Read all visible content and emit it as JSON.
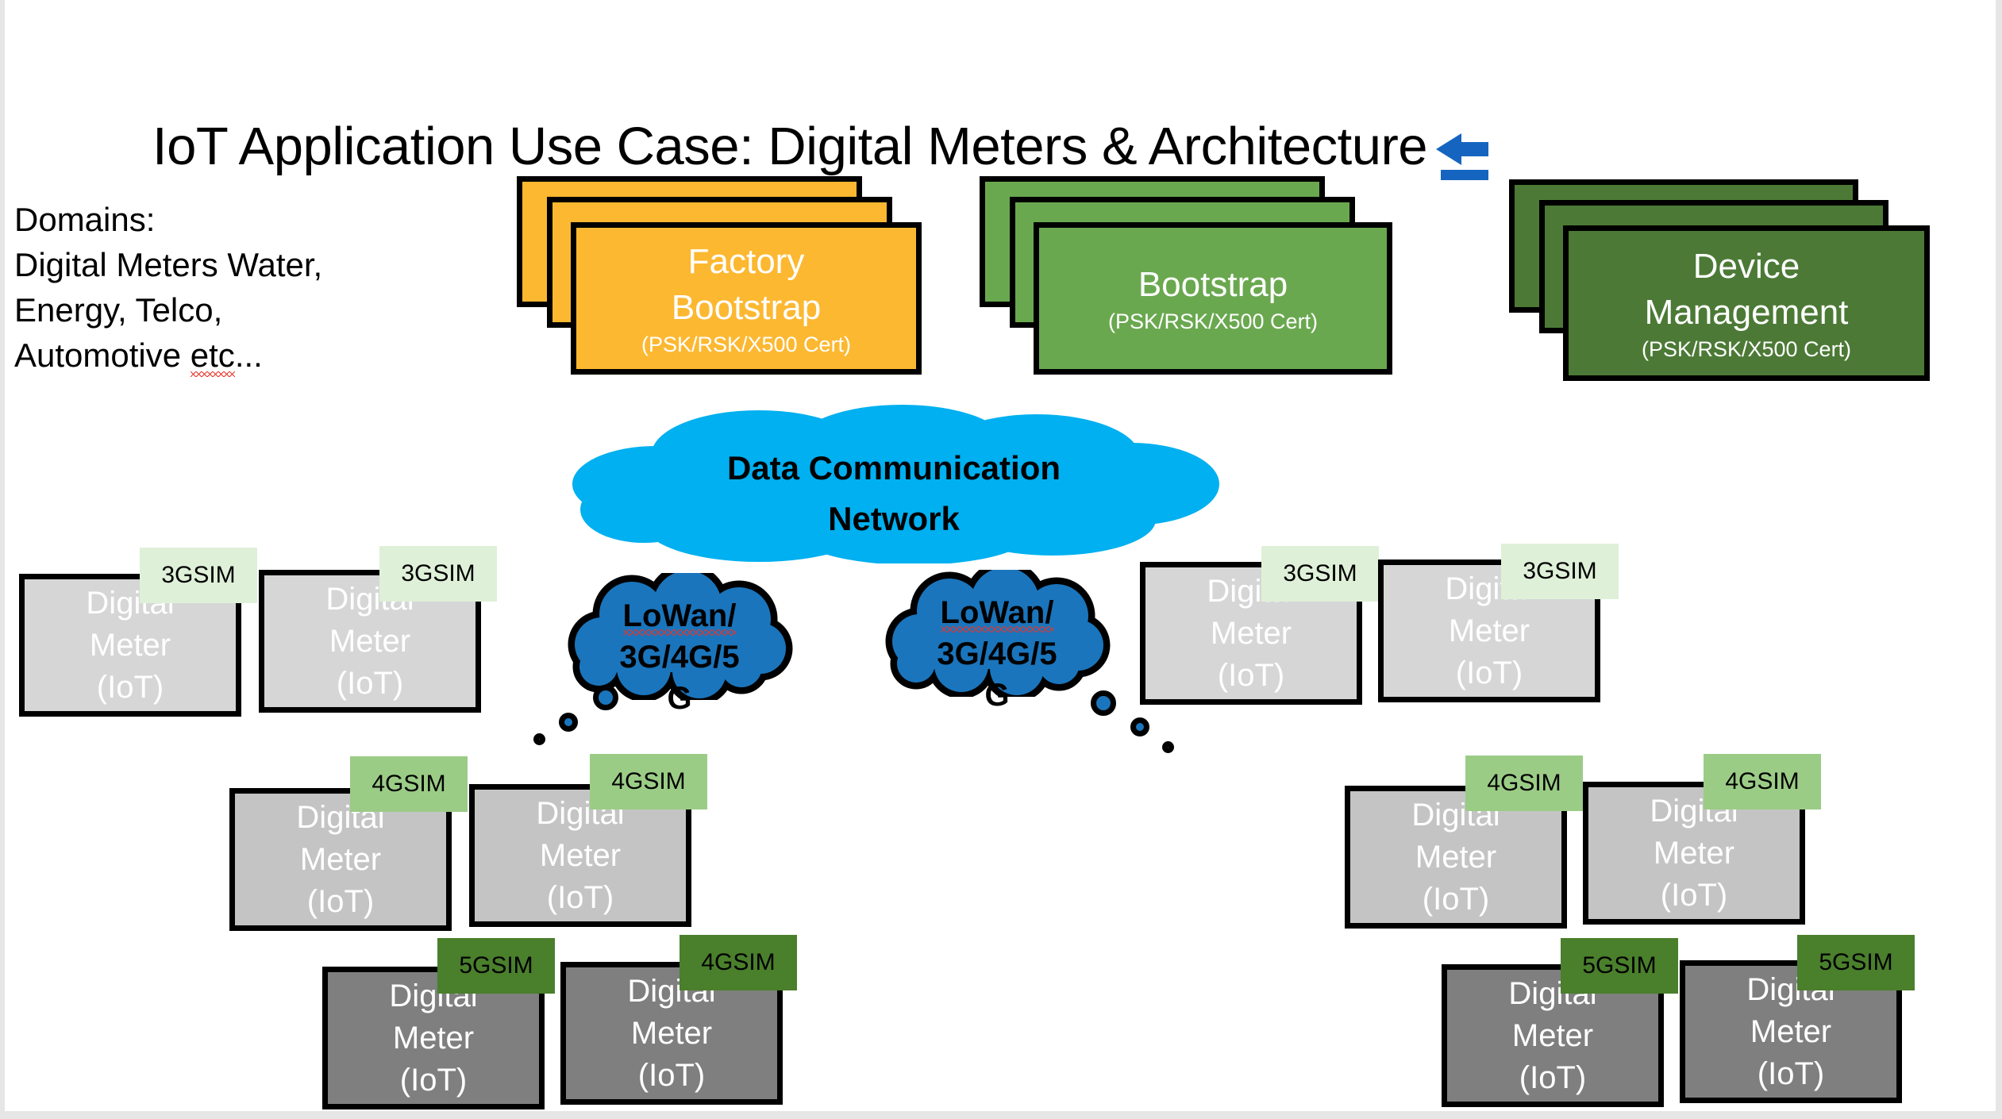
{
  "slide": {
    "title": "IoT Application Use Case: Digital Meters & Architecture",
    "title_arrow_icon": "arrow-left-icon",
    "domains_label": "Domains:",
    "domains_line2": "Digital Meters Water,",
    "domains_line3": "Energy, Telco,",
    "domains_line4_a": "Automotive ",
    "domains_line4_b": "etc",
    "domains_line4_c": "..."
  },
  "colors": {
    "factory_bootstrap": "#fcb831",
    "bootstrap": "#6aa84f",
    "device_management": "#4c7a36",
    "network_cloud": "#00b0f0",
    "lowan_cloud": "#1a75bc",
    "sim3_tag": "#dff0d8",
    "sim4_tag": "#9bcc86",
    "sim5_tag": "#4a7f2c",
    "meter_light": "#d6d6d6",
    "meter_mid": "#c4c4c4",
    "meter_dark": "#7f7f7f",
    "title_arrow": "#1565c0",
    "outline": "#000000"
  },
  "services": [
    {
      "name": "factory-bootstrap",
      "title_line1": "Factory",
      "title_line2": "Bootstrap",
      "subtitle": "(PSK/RSK/X500 Cert)",
      "fill": "#fcb831"
    },
    {
      "name": "bootstrap",
      "title_line1": "Bootstrap",
      "title_line2": "",
      "subtitle": "(PSK/RSK/X500 Cert)",
      "fill": "#6aa84f"
    },
    {
      "name": "device-management",
      "title_line1": "Device",
      "title_line2": "Management",
      "subtitle": "(PSK/RSK/X500 Cert)",
      "fill": "#4c7a36"
    }
  ],
  "network_cloud": {
    "line1": "Data Communication",
    "line2": "Network"
  },
  "lowan_clouds": [
    {
      "line1": "LoWan/",
      "line2": "3G/4G/5",
      "line3": "G"
    },
    {
      "line1": "LoWan/",
      "line2": "3G/4G/5",
      "line3": "G"
    }
  ],
  "meters": [
    {
      "id": "m1",
      "line1": "Digital",
      "line2": "Meter",
      "line3": "(IoT)",
      "sim": "3GSIM",
      "tier": "3g",
      "side": "left"
    },
    {
      "id": "m2",
      "line1": "Digital",
      "line2": "Meter",
      "line3": "(IoT)",
      "sim": "3GSIM",
      "tier": "3g",
      "side": "left"
    },
    {
      "id": "m3",
      "line1": "Digital",
      "line2": "Meter",
      "line3": "(IoT)",
      "sim": "4GSIM",
      "tier": "4g",
      "side": "left"
    },
    {
      "id": "m4",
      "line1": "Digital",
      "line2": "Meter",
      "line3": "(IoT)",
      "sim": "4GSIM",
      "tier": "4g",
      "side": "left"
    },
    {
      "id": "m5",
      "line1": "Digital",
      "line2": "Meter",
      "line3": "(IoT)",
      "sim": "5GSIM",
      "tier": "5g",
      "side": "left"
    },
    {
      "id": "m6",
      "line1": "Digital",
      "line2": "Meter",
      "line3": "(IoT)",
      "sim": "4GSIM",
      "tier": "5g",
      "side": "left"
    },
    {
      "id": "m7",
      "line1": "Digital",
      "line2": "Meter",
      "line3": "(IoT)",
      "sim": "3GSIM",
      "tier": "3g",
      "side": "right"
    },
    {
      "id": "m8",
      "line1": "Digital",
      "line2": "Meter",
      "line3": "(IoT)",
      "sim": "3GSIM",
      "tier": "3g",
      "side": "right"
    },
    {
      "id": "m9",
      "line1": "Digital",
      "line2": "Meter",
      "line3": "(IoT)",
      "sim": "4GSIM",
      "tier": "4g",
      "side": "right"
    },
    {
      "id": "m10",
      "line1": "Digital",
      "line2": "Meter",
      "line3": "(IoT)",
      "sim": "4GSIM",
      "tier": "4g",
      "side": "right"
    },
    {
      "id": "m11",
      "line1": "Digital",
      "line2": "Meter",
      "line3": "(IoT)",
      "sim": "5GSIM",
      "tier": "5g",
      "side": "right"
    },
    {
      "id": "m12",
      "line1": "Digital",
      "line2": "Meter",
      "line3": "(IoT)",
      "sim": "5GSIM",
      "tier": "5g",
      "side": "right"
    }
  ]
}
